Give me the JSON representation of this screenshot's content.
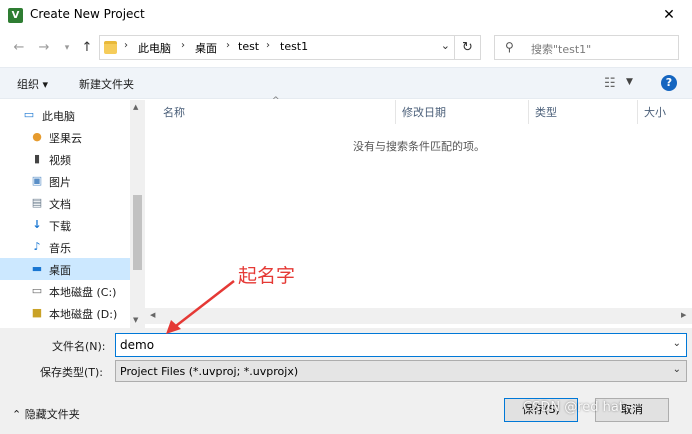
{
  "window": {
    "title": "Create New Project",
    "app_icon_letter": "V"
  },
  "nav": {
    "breadcrumb": [
      "此电脑",
      "桌面",
      "test",
      "test1"
    ],
    "search_placeholder": "搜索\"test1\""
  },
  "toolbar": {
    "organize": "组织 ▾",
    "new_folder": "新建文件夹"
  },
  "sidebar": {
    "items": [
      {
        "label": "此电脑",
        "icon": "computer-icon"
      },
      {
        "label": "坚果云",
        "icon": "nutstore-icon"
      },
      {
        "label": "视频",
        "icon": "video-icon"
      },
      {
        "label": "图片",
        "icon": "pictures-icon"
      },
      {
        "label": "文档",
        "icon": "documents-icon"
      },
      {
        "label": "下载",
        "icon": "download-icon"
      },
      {
        "label": "音乐",
        "icon": "music-icon"
      },
      {
        "label": "桌面",
        "icon": "desktop-icon",
        "selected": true
      },
      {
        "label": "本地磁盘 (C:)",
        "icon": "drive-icon"
      },
      {
        "label": "本地磁盘 (D:)",
        "icon": "drive-icon"
      }
    ]
  },
  "columns": [
    "名称",
    "修改日期",
    "类型",
    "大小"
  ],
  "empty_message": "没有与搜索条件匹配的项。",
  "form": {
    "filename_label": "文件名(N):",
    "filename_value": "demo",
    "filetype_label": "保存类型(T):",
    "filetype_value": "Project Files (*.uvproj; *.uvprojx)"
  },
  "footer": {
    "hide_folders": "隐藏文件夹",
    "save": "保存(S)",
    "cancel": "取消"
  },
  "annotation": {
    "text": "起名字",
    "color": "#e53935"
  },
  "watermark": "CSDN @red hat~",
  "colors": {
    "selection": "#cce8ff",
    "focus_border": "#0078d7",
    "toolbar_bg": "#f0f4f9"
  }
}
